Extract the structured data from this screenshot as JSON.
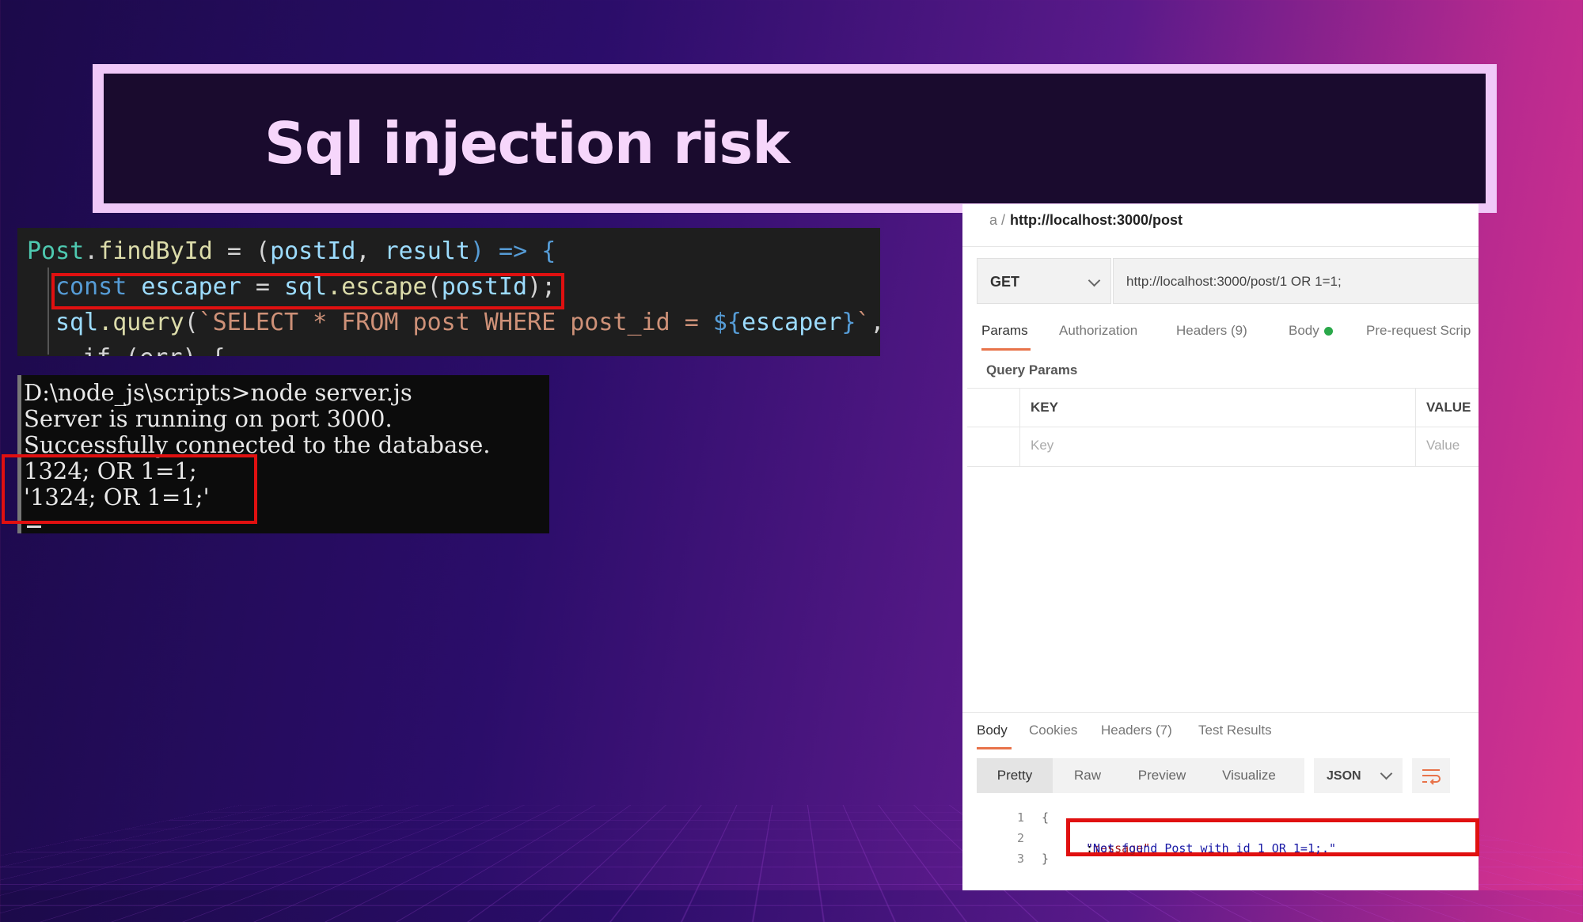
{
  "slide": {
    "title": "Sql injection risk"
  },
  "code": {
    "line1": {
      "obj": "Post",
      "dot": ".",
      "fn": "findById",
      "rest": " = (",
      "p1": "postId",
      "comma": ", ",
      "p2": "result",
      "close": ") => {"
    },
    "line2": {
      "kw": "const",
      "var": " escaper",
      "eq": " = ",
      "obj": "sql",
      "fn": ".escape",
      "open": "(",
      "arg": "postId",
      "close": ");"
    },
    "line3": {
      "obj": "sql",
      "fn": ".query",
      "open": "(",
      "str": "`SELECT * FROM post WHERE post_id = ",
      "tpl": "${",
      "var": "escaper",
      "tplc": "}",
      "strc": "`",
      "tail": ","
    },
    "line4": "if (err) {"
  },
  "terminal": {
    "lines": [
      "D:\\node_js\\scripts>node server.js",
      "Server is running on port 3000.",
      "Successfully connected to the database.",
      "1324; OR 1=1;",
      "'1324; OR 1=1;'"
    ]
  },
  "postman": {
    "breadcrumb_prefix": "a /",
    "breadcrumb_url": "http://localhost:3000/post",
    "method": "GET",
    "url": "http://localhost:3000/post/1 OR 1=1;",
    "tabs": [
      "Params",
      "Authorization",
      "Headers (9)",
      "Body",
      "Pre-request Scrip"
    ],
    "query_params_label": "Query Params",
    "table": {
      "key_header": "KEY",
      "value_header": "VALUE",
      "key_placeholder": "Key",
      "value_placeholder": "Value"
    },
    "response_tabs": [
      "Body",
      "Cookies",
      "Headers (7)",
      "Test Results"
    ],
    "view_modes": [
      "Pretty",
      "Raw",
      "Preview",
      "Visualize"
    ],
    "format": "JSON",
    "response_lines": [
      "1",
      "2",
      "3"
    ],
    "open_brace": "{",
    "close_brace": "}",
    "message_key": "\"message\"",
    "message_sep": ": ",
    "message_value": "\"Not found Post with id 1 OR 1=1;.\""
  },
  "colors": {
    "highlight": "#e01010",
    "tab_accent": "#e8734a",
    "body_dot": "#2aa84a"
  }
}
